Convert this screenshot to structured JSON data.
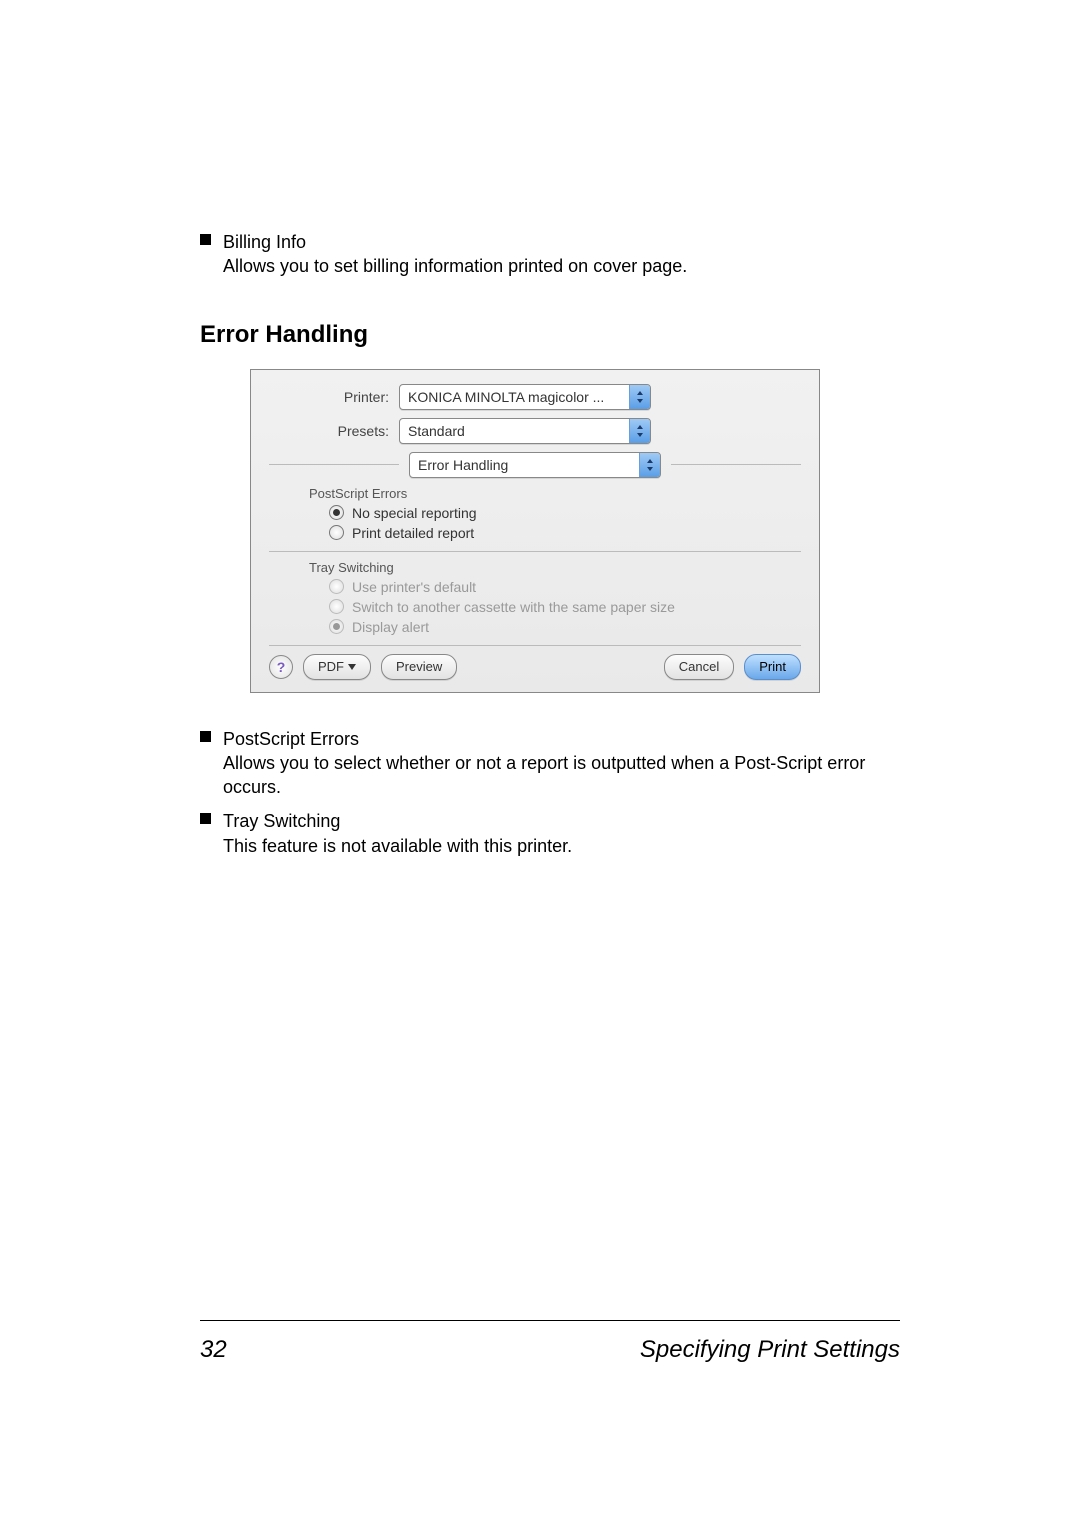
{
  "bullets_top": [
    {
      "title": "Billing Info",
      "desc": "Allows you to set billing information printed on cover page."
    }
  ],
  "section_heading": "Error Handling",
  "dialog": {
    "labels": {
      "printer": "Printer:",
      "presets": "Presets:"
    },
    "printer": "KONICA MINOLTA magicolor ...",
    "presets": "Standard",
    "pane": "Error Handling",
    "group1_label": "PostScript Errors",
    "group1_options": [
      {
        "label": "No special reporting",
        "selected": true
      },
      {
        "label": "Print detailed report",
        "selected": false
      }
    ],
    "group2_label": "Tray Switching",
    "group2_options": [
      {
        "label": "Use printer's default",
        "selected": false
      },
      {
        "label": "Switch to another cassette with the same paper size",
        "selected": false
      },
      {
        "label": "Display alert",
        "selected": true
      }
    ],
    "buttons": {
      "help": "?",
      "pdf": "PDF",
      "preview": "Preview",
      "cancel": "Cancel",
      "print": "Print"
    }
  },
  "bullets_bottom": [
    {
      "title": "PostScript Errors",
      "desc": "Allows you to select whether or not a report is outputted when a Post-Script error occurs."
    },
    {
      "title": "Tray Switching",
      "desc": "This feature is not available with this printer."
    }
  ],
  "footer": {
    "page_number": "32",
    "title": "Specifying Print Settings"
  }
}
